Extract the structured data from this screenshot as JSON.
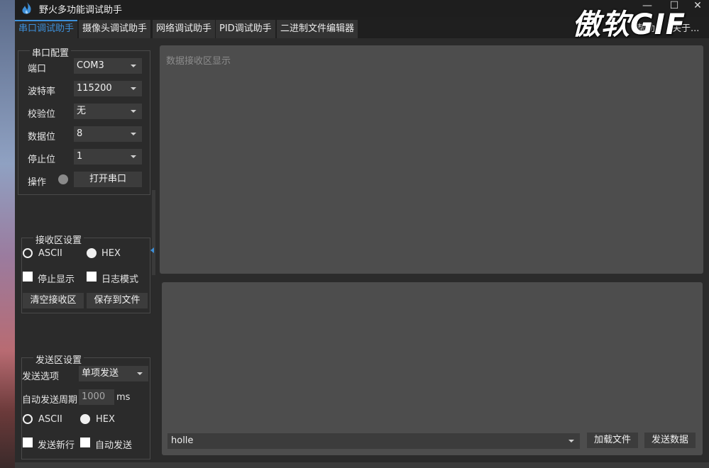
{
  "window": {
    "title": "野火多功能调试助手",
    "controls": {
      "minimize": "—",
      "maximize": "☐",
      "close": "✕"
    }
  },
  "watermark": "傲软GIF",
  "tabs": [
    {
      "label": "串口调试助手",
      "active": true
    },
    {
      "label": "摄像头调试助手",
      "active": false
    },
    {
      "label": "网络调试助手",
      "active": false
    },
    {
      "label": "PID调试助手",
      "active": false
    },
    {
      "label": "二进制文件编辑器",
      "active": false
    }
  ],
  "tabs_right": {
    "help": "帮助",
    "about": "关于..."
  },
  "serial_config": {
    "title": "串口配置",
    "port": {
      "label": "端口",
      "value": "COM3"
    },
    "baud": {
      "label": "波特率",
      "value": "115200"
    },
    "parity": {
      "label": "校验位",
      "value": "无"
    },
    "databits": {
      "label": "数据位",
      "value": "8"
    },
    "stopbits": {
      "label": "停止位",
      "value": "1"
    },
    "operation": {
      "label": "操作",
      "button": "打开串口"
    }
  },
  "recv_settings": {
    "title": "接收区设置",
    "ascii": "ASCII",
    "hex": "HEX",
    "selected": "HEX",
    "stop_display": "停止显示",
    "log_mode": "日志模式",
    "clear_button": "清空接收区",
    "save_button": "保存到文件"
  },
  "send_settings": {
    "title": "发送区设置",
    "option_label": "发送选项",
    "option_value": "单项发送",
    "period_label": "自动发送周期",
    "period_value": "1000",
    "period_unit": "ms",
    "ascii": "ASCII",
    "hex": "HEX",
    "selected": "HEX",
    "newline": "发送新行",
    "auto_send": "自动发送"
  },
  "receive_area": {
    "placeholder": "数据接收区显示"
  },
  "send_area": {
    "input_value": "holle",
    "load_button": "加载文件",
    "send_button": "发送数据"
  },
  "colors": {
    "accent": "#3d8fd8",
    "panel": "#4d4d4d",
    "background": "#2b2b2b"
  }
}
